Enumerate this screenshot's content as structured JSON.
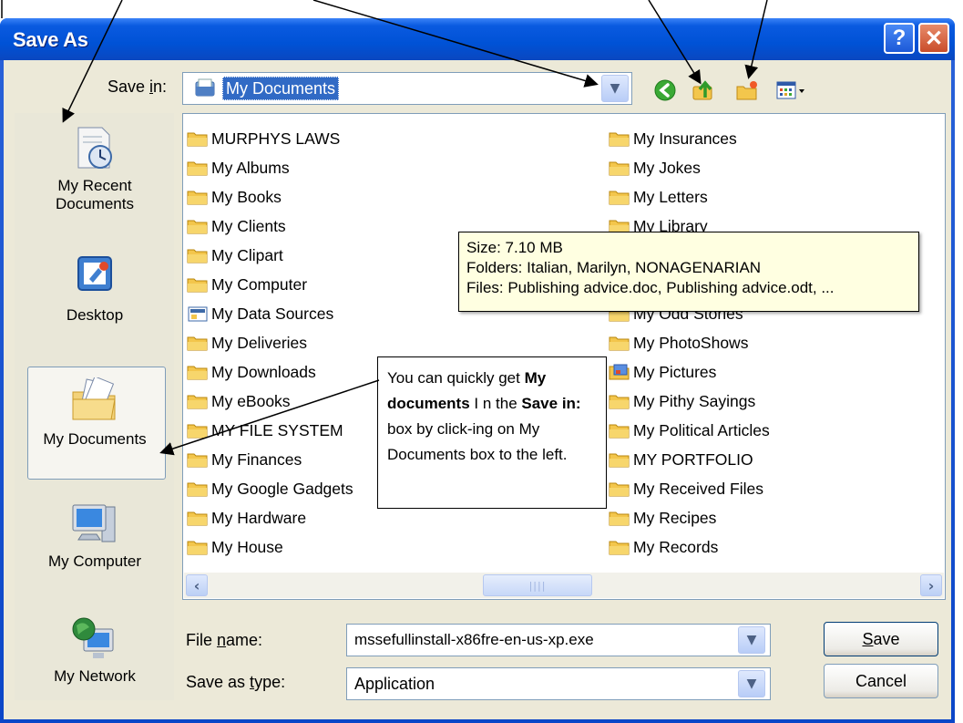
{
  "window": {
    "title": "Save As",
    "help_glyph": "?",
    "close_glyph": "✕"
  },
  "save_in": {
    "label": "Save in:",
    "label_parts": [
      "Save ",
      "i",
      "n:"
    ],
    "value": "My Documents",
    "toolbar": [
      "back-icon",
      "up-folder-icon",
      "new-folder-icon",
      "views-menu-icon"
    ]
  },
  "places": [
    {
      "label_lines": [
        "My Recent",
        "Documents"
      ],
      "icon": "recent-documents-icon"
    },
    {
      "label_lines": [
        "Desktop"
      ],
      "icon": "desktop-icon"
    },
    {
      "label_lines": [
        "My Documents"
      ],
      "icon": "my-documents-icon",
      "selected": true
    },
    {
      "label_lines": [
        "My Computer"
      ],
      "icon": "my-computer-icon"
    },
    {
      "label_lines": [
        "My Network"
      ],
      "icon": "my-network-icon"
    }
  ],
  "files": {
    "column1": [
      "MURPHYS LAWS",
      "My Albums",
      "My Books",
      "My Clients",
      "My Clipart",
      "My Computer",
      "My Data Sources",
      "My Deliveries",
      "My Downloads",
      "My eBooks",
      "MY FILE SYSTEM",
      "My Finances",
      "My Google Gadgets",
      "My Hardware",
      "My House"
    ],
    "column2": [
      "My Insurances",
      "My Jokes",
      "My Letters",
      "My Library",
      "",
      "",
      "My Odd Stories",
      "My PhotoShows",
      "My Pictures",
      "My Pithy Sayings",
      "My Political Articles",
      "MY PORTFOLIO",
      "My Received Files",
      "My Recipes",
      "My Records"
    ]
  },
  "tooltip": {
    "lines": [
      "Size: 7.10 MB",
      "Folders: Italian, Marilyn, NONAGENARIAN",
      "Files: Publishing advice.doc, Publishing advice.odt, ..."
    ]
  },
  "callout": {
    "text1": "You can quickly get ",
    "bold1": "My documents",
    "text2": " I n the ",
    "bold2": "Save in:",
    "text3": " box by click-ing on My Documents box to the left."
  },
  "file_name": {
    "label_pre": "File ",
    "label_u": "n",
    "label_post": "ame:",
    "value": "mssefullinstall-x86fre-en-us-xp.exe"
  },
  "save_as_type": {
    "label_pre": "Save as ",
    "label_u": "t",
    "label_post": "ype:",
    "value": "Application"
  },
  "buttons": {
    "save_u": "S",
    "save_rest": "ave",
    "cancel": "Cancel"
  },
  "colors": {
    "title_bar": "#0052d6",
    "selection": "#316ac5",
    "dialog_bg": "#ece9d8",
    "tooltip_bg": "#ffffe1"
  }
}
